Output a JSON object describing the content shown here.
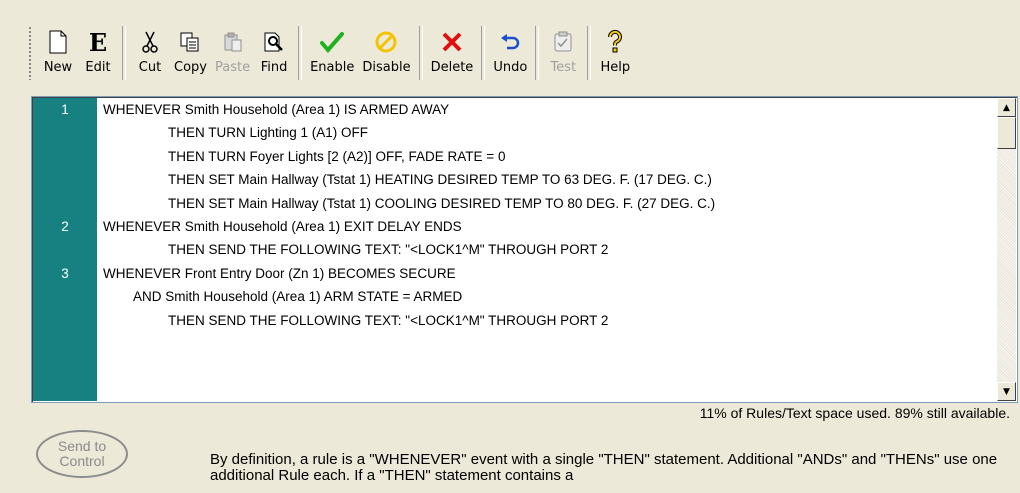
{
  "toolbar": {
    "new": "New",
    "edit": "Edit",
    "cut": "Cut",
    "copy": "Copy",
    "paste": "Paste",
    "find": "Find",
    "enable": "Enable",
    "disable": "Disable",
    "delete": "Delete",
    "undo": "Undo",
    "test": "Test",
    "help": "Help",
    "edit_glyph": "E",
    "colors": {
      "enable": "#1fb11f",
      "disable": "#f4c400",
      "delete": "#e01010",
      "undo": "#1e4fc8"
    }
  },
  "rules": {
    "rows": [
      {
        "num": "1",
        "text": "WHENEVER  Smith Household (Area 1) IS ARMED AWAY"
      },
      {
        "num": "",
        "text": "THEN TURN Lighting 1 (A1) OFF"
      },
      {
        "num": "",
        "text": "THEN TURN Foyer Lights [2 (A2)] OFF, FADE RATE = 0"
      },
      {
        "num": "",
        "text": "THEN SET Main Hallway (Tstat 1) HEATING DESIRED TEMP TO 63 DEG. F. (17 DEG. C.)"
      },
      {
        "num": "",
        "text": "THEN SET Main Hallway (Tstat 1) COOLING DESIRED TEMP TO 80 DEG. F. (27 DEG. C.)"
      },
      {
        "num": "2",
        "text": "WHENEVER  Smith Household (Area 1) EXIT DELAY ENDS"
      },
      {
        "num": "",
        "text": "THEN SEND THE FOLLOWING TEXT: \"<LOCK1^M\" THROUGH PORT 2"
      },
      {
        "num": "3",
        "text": "WHENEVER Front Entry Door (Zn 1) BECOMES SECURE"
      },
      {
        "num": "",
        "text": "AND Smith Household (Area 1) ARM STATE = ARMED"
      },
      {
        "num": "",
        "text": "THEN SEND THE FOLLOWING TEXT: \"<LOCK1^M\" THROUGH PORT 2"
      },
      {
        "num": "",
        "text": ""
      },
      {
        "num": "",
        "text": ""
      },
      {
        "num": "",
        "text": ""
      }
    ],
    "gutter_color": "#178080"
  },
  "usage_text": "11% of Rules/Text space used.  89% still available.",
  "send_button": {
    "line1": "Send to",
    "line2": "Control"
  },
  "info_text": "By definition, a rule is a \"WHENEVER\" event with a single \"THEN\" statement.  Additional \"ANDs\" and \"THENs\" use one additional Rule each.  If a \"THEN\" statement contains a"
}
